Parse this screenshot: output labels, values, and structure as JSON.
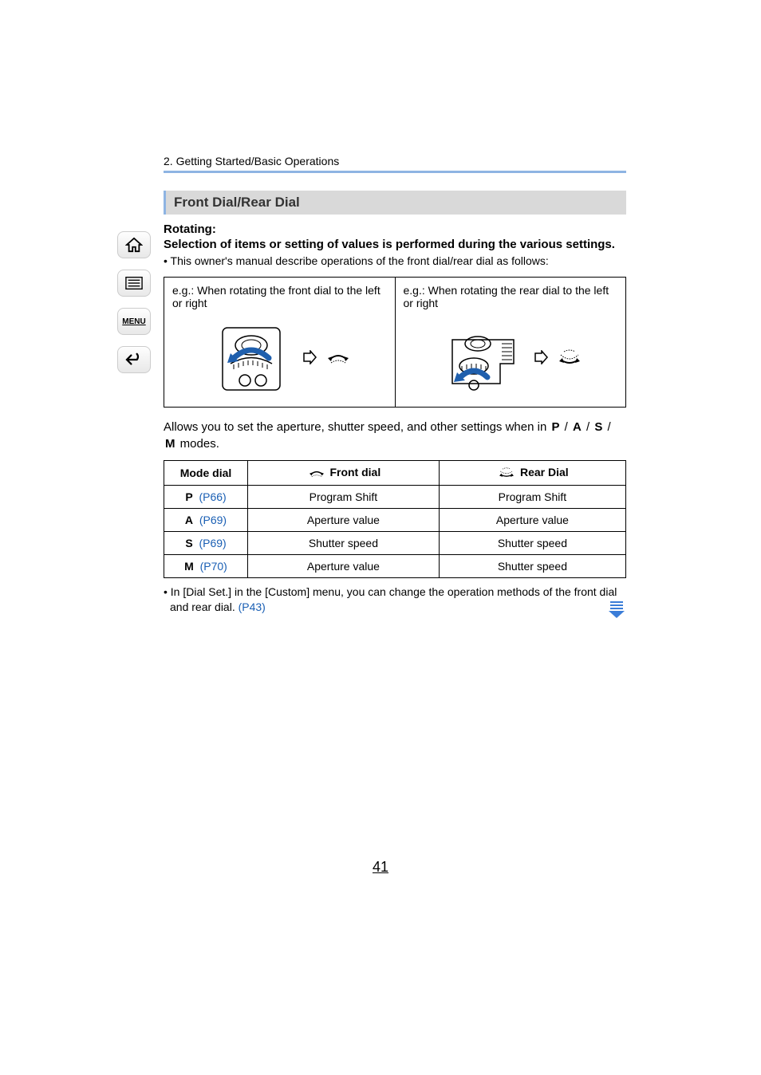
{
  "breadcrumb": "2. Getting Started/Basic Operations",
  "section_title": "Front Dial/Rear Dial",
  "rotating_label": "Rotating:",
  "selection_text": "Selection of items or setting of values is performed during the various settings.",
  "bullet1": "This owner's manual describe operations of the front dial/rear dial as follows:",
  "diagrams": {
    "left": "e.g.: When rotating the front dial to the left or right",
    "right": "e.g.: When rotating the rear dial to the left or right"
  },
  "allows_prefix": "Allows you to set the aperture, shutter speed, and other settings when in ",
  "allows_suffix": " modes.",
  "mode_sep": " / ",
  "modes_inline": [
    "P",
    "A",
    "S",
    "M"
  ],
  "table": {
    "headers": [
      "Mode dial",
      "Front dial",
      "Rear Dial"
    ],
    "rows": [
      {
        "mode": "P",
        "link": "(P66)",
        "front": "Program Shift",
        "rear": "Program Shift"
      },
      {
        "mode": "A",
        "link": "(P69)",
        "front": "Aperture value",
        "rear": "Aperture value"
      },
      {
        "mode": "S",
        "link": "(P69)",
        "front": "Shutter speed",
        "rear": "Shutter speed"
      },
      {
        "mode": "M",
        "link": "(P70)",
        "front": "Aperture value",
        "rear": "Shutter speed"
      }
    ]
  },
  "footnote_prefix": "In [Dial Set.] in the [Custom] menu, you can change the operation methods of the front dial and rear dial. ",
  "footnote_link": "(P43)",
  "page_number": "41",
  "sidebar": {
    "home": "home-icon",
    "list": "contents-icon",
    "menu": "MENU",
    "back": "back-icon"
  }
}
